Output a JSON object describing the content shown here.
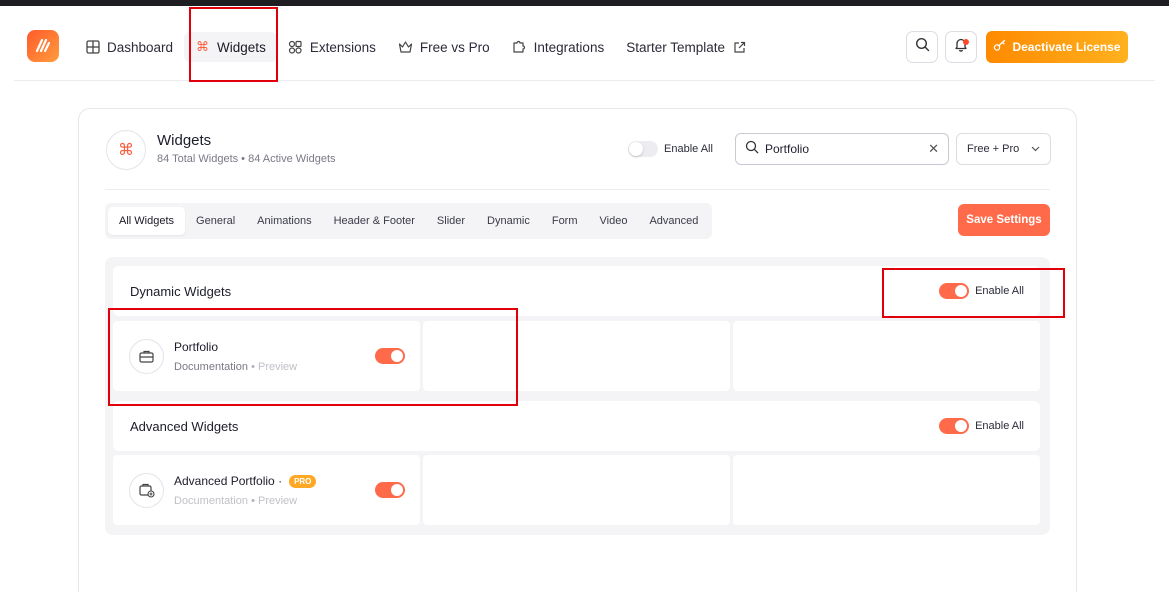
{
  "header": {
    "nav": [
      {
        "label": "Dashboard",
        "icon": "grid-icon"
      },
      {
        "label": "Widgets",
        "icon": "command-icon",
        "active": true
      },
      {
        "label": "Extensions",
        "icon": "extensions-icon"
      },
      {
        "label": "Free vs Pro",
        "icon": "crown-icon"
      },
      {
        "label": "Integrations",
        "icon": "puzzle-icon"
      },
      {
        "label": "Starter Template",
        "icon": "external-link-icon"
      }
    ],
    "deactivate_label": "Deactivate License"
  },
  "widgets_panel": {
    "title": "Widgets",
    "subtitle": "84 Total Widgets • 84 Active Widgets",
    "enable_all_label": "Enable All",
    "enable_all_on": false,
    "search": {
      "value": "Portfolio",
      "placeholder": "Search"
    },
    "filter_value": "Free + Pro",
    "tabs": [
      "All Widgets",
      "General",
      "Animations",
      "Header & Footer",
      "Slider",
      "Dynamic",
      "Form",
      "Video",
      "Advanced"
    ],
    "active_tab": "All Widgets",
    "save_label": "Save Settings"
  },
  "sections": [
    {
      "title": "Dynamic Widgets",
      "enable_all_label": "Enable All",
      "enabled": true,
      "widgets": [
        {
          "name": "Portfolio",
          "doc_label": "Documentation",
          "sep": "•",
          "preview_label": "Preview",
          "enabled": true,
          "icon": "briefcase-icon",
          "pro": false
        }
      ]
    },
    {
      "title": "Advanced Widgets",
      "enable_all_label": "Enable All",
      "enabled": true,
      "widgets": [
        {
          "name": "Advanced Portfolio ·",
          "pro_label": "PRO",
          "doc_label": "Documentation",
          "sep": "•",
          "preview_label": "Preview",
          "enabled": true,
          "icon": "briefcase-plus-icon",
          "pro": true
        }
      ]
    }
  ],
  "colors": {
    "accent": "#ff6b4a",
    "highlight": "#e0000a",
    "pro_badge": "#ffa825"
  }
}
